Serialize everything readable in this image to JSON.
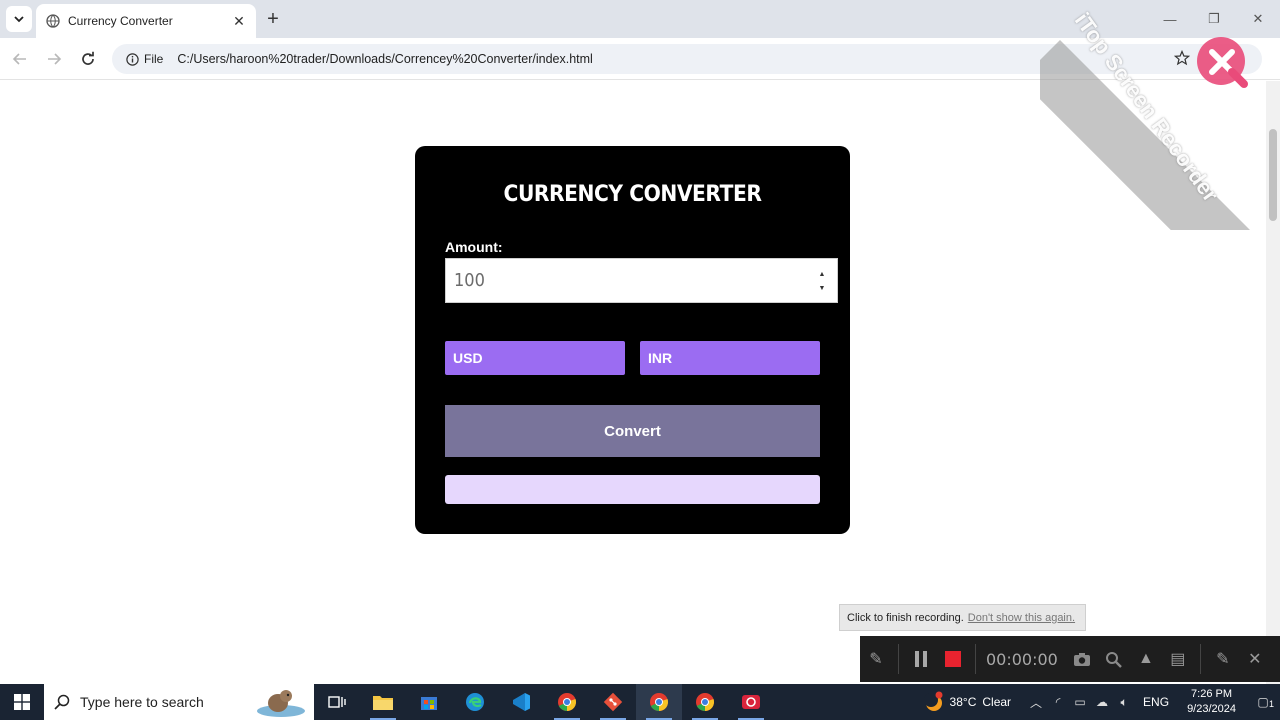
{
  "browser": {
    "tab_title": "Currency Converter",
    "address_chip": "File",
    "url": "C:/Users/haroon%20trader/Downloads/Correncey%20Converter/index.html"
  },
  "app": {
    "title": "CURRENCY CONVERTER",
    "amount_label": "Amount:",
    "amount_value": "100",
    "from_currency": "USD",
    "to_currency": "INR",
    "convert_label": "Convert",
    "result_text": ""
  },
  "watermark": {
    "text": "iTop Screen Recorder"
  },
  "recorder": {
    "toast_text": "Click to finish recording.",
    "toast_link": "Don't show this again.",
    "timer": "00:00:00"
  },
  "taskbar": {
    "search_placeholder": "Type here to search",
    "weather_temp": "38°C",
    "weather_desc": "Clear",
    "language": "ENG",
    "time": "7:26 PM",
    "date": "9/23/2024",
    "notification_count": "1"
  },
  "colors": {
    "card_bg": "#000000",
    "select_bg": "#9b6cf2",
    "convert_bg": "#79749b",
    "result_bg": "#e6d7fd",
    "taskbar_bg": "#1a2433"
  },
  "icons": [
    "tab-search-icon",
    "globe-icon",
    "close-icon",
    "plus-icon",
    "back-icon",
    "forward-icon",
    "reload-icon",
    "info-icon",
    "star-icon",
    "minimize-icon",
    "maximize-icon",
    "windows-icon",
    "search-icon",
    "pause-icon",
    "stop-icon",
    "camera-icon",
    "zoom-icon"
  ]
}
